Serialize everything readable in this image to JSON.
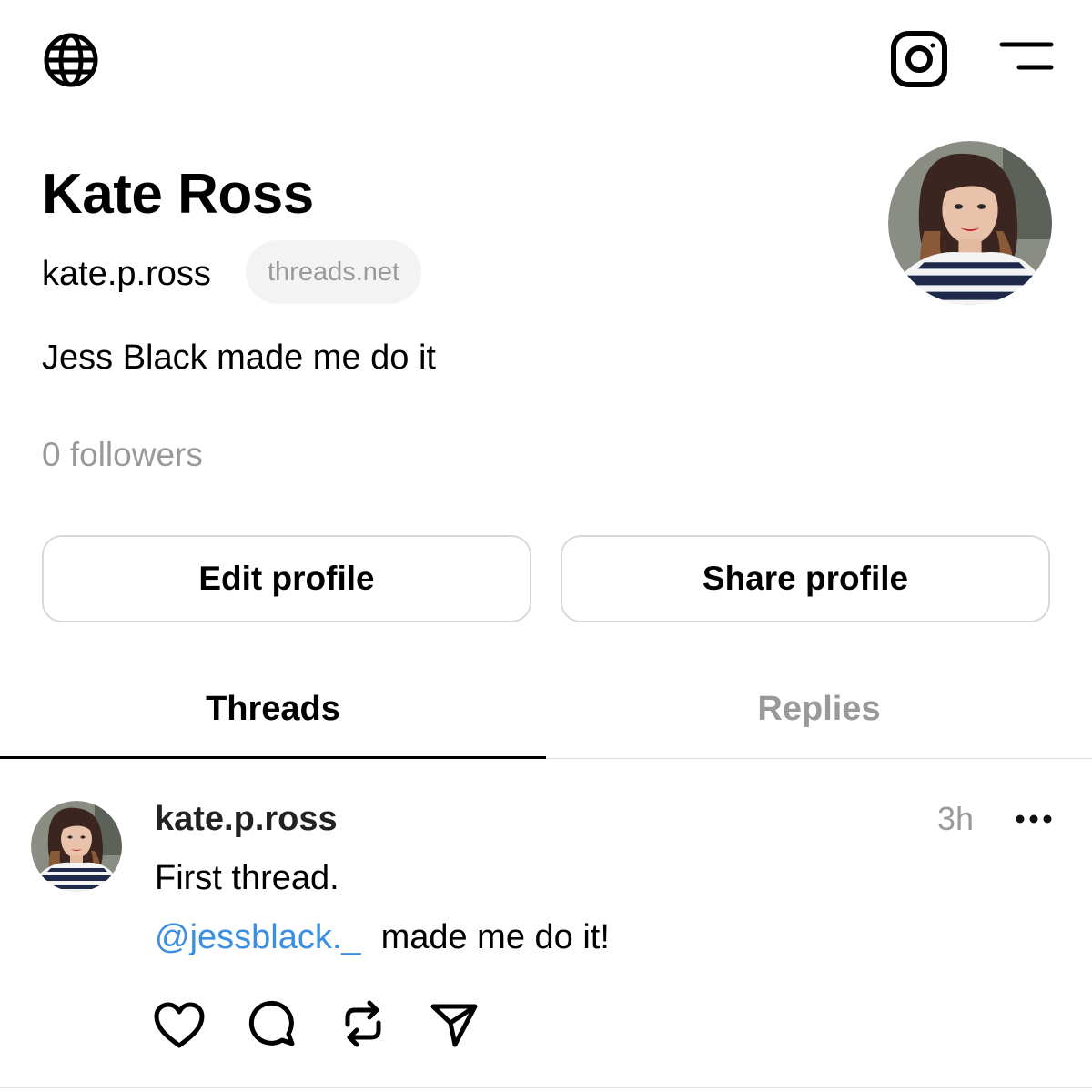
{
  "header": {
    "left_icon": "globe-icon",
    "right_icons": [
      "instagram-icon",
      "menu-icon"
    ]
  },
  "profile": {
    "name": "Kate Ross",
    "handle": "kate.p.ross",
    "domain_badge": "threads.net",
    "bio": "Jess Black made me do it",
    "followers": "0 followers",
    "avatar": "profile-photo"
  },
  "buttons": {
    "edit": "Edit profile",
    "share": "Share profile"
  },
  "tabs": [
    {
      "label": "Threads",
      "active": true
    },
    {
      "label": "Replies",
      "active": false
    }
  ],
  "post": {
    "username": "kate.p.ross",
    "time": "3h",
    "line1": "First thread.",
    "mention": "@jessblack._",
    "line2_rest": "made me do it!",
    "actions": [
      "heart-icon",
      "comment-icon",
      "repost-icon",
      "send-icon"
    ]
  },
  "colors": {
    "text": "#000000",
    "muted": "#999999",
    "mention": "#3b8fe0",
    "border": "#d9d9d9",
    "badge_bg": "#f3f3f3"
  }
}
